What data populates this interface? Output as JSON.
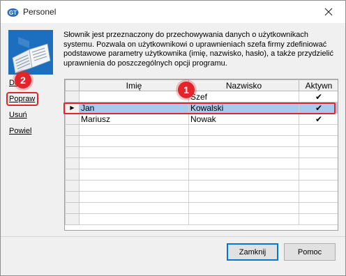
{
  "window": {
    "title": "Personel",
    "app_icon_text": "GT"
  },
  "description": "Słownik jest przeznaczony do przechowywania danych o użytkownikach systemu. Pozwala on użytkownikowi o uprawnieniach szefa firmy zdefiniować podstawowe parametry użytkownika (imię, nazwisko, hasło), a także przydzielić uprawnienia do poszczególnych opcji programu.",
  "side_links": [
    "Dodaj",
    "Popraw",
    "Usuń",
    "Powiel"
  ],
  "grid": {
    "columns": [
      "Imię",
      "Nazwisko",
      "Aktywn"
    ],
    "rows": [
      {
        "first_name": "",
        "last_name": "Szef",
        "active": "✔",
        "selected": false
      },
      {
        "first_name": "Jan",
        "last_name": "Kowalski",
        "active": "✔",
        "selected": true
      },
      {
        "first_name": "Mariusz",
        "last_name": "Nowak",
        "active": "✔",
        "selected": false
      }
    ],
    "empty_rows": 9,
    "row_indicator": "▶"
  },
  "annotations": {
    "badge_1": "1",
    "badge_2": "2",
    "color": "#e3242b"
  },
  "buttons": {
    "close_label": "Zamknij",
    "help_label": "Pomoc"
  },
  "icons": {
    "close": "close-icon",
    "logo": "open-book-icon"
  }
}
